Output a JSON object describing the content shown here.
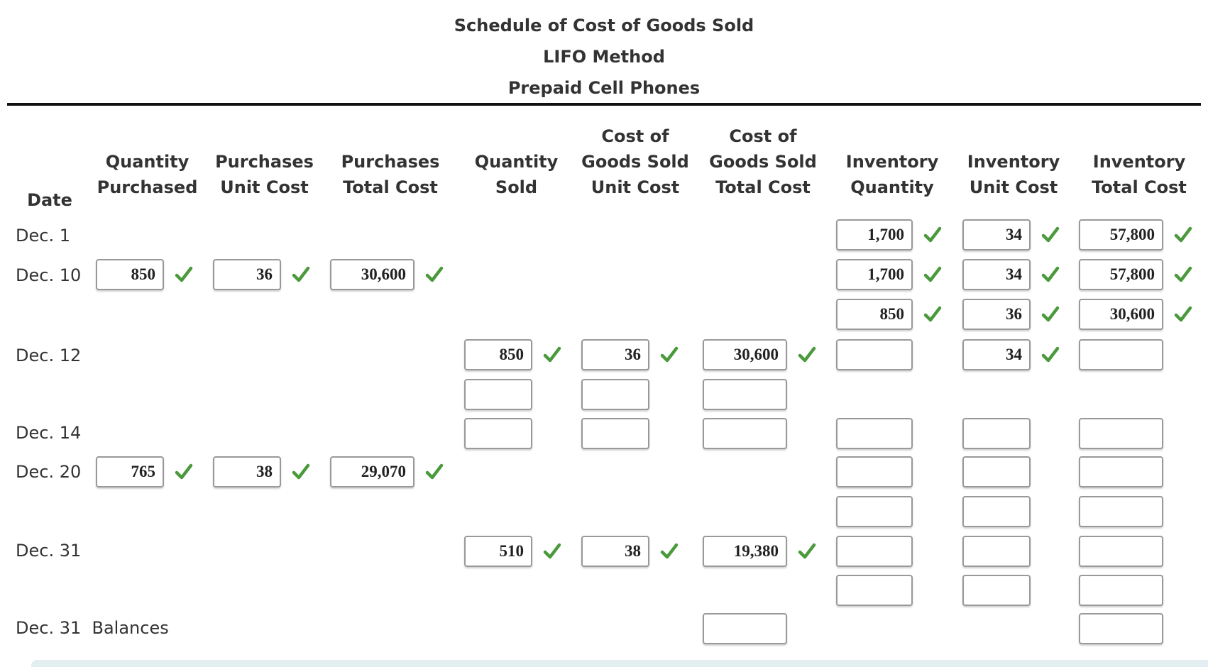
{
  "title": {
    "line1": "Schedule of Cost of Goods Sold",
    "line2": "LIFO Method",
    "line3": "Prepaid Cell Phones"
  },
  "headers": {
    "date": "Date",
    "qty_purchased": [
      "Quantity",
      "Purchased"
    ],
    "purch_unit": [
      "Purchases",
      "Unit Cost"
    ],
    "purch_total": [
      "Purchases",
      "Total Cost"
    ],
    "qty_sold": [
      "Quantity",
      "Sold"
    ],
    "cogs_unit": [
      "Cost of",
      "Goods Sold",
      "Unit Cost"
    ],
    "cogs_total": [
      "Cost of",
      "Goods Sold",
      "Total Cost"
    ],
    "inv_qty": [
      "Inventory",
      "Quantity"
    ],
    "inv_unit": [
      "Inventory",
      "Unit Cost"
    ],
    "inv_total": [
      "Inventory",
      "Total Cost"
    ]
  },
  "dates": {
    "r0": "Dec. 1",
    "r1": "Dec. 10",
    "r3": "Dec. 12",
    "r5": "Dec. 14",
    "r6": "Dec. 20",
    "r8": "Dec. 31",
    "r10": "Dec. 31  Balances"
  },
  "check_color": "#4a9a3c",
  "rows": [
    {
      "inv_qty": {
        "value": "1,700",
        "correct": true
      },
      "inv_unit": {
        "value": "34",
        "correct": true
      },
      "inv_total": {
        "value": "57,800",
        "correct": true
      }
    },
    {
      "qty_purchased": {
        "value": "850",
        "correct": true
      },
      "purch_unit": {
        "value": "36",
        "correct": true
      },
      "purch_total": {
        "value": "30,600",
        "correct": true
      },
      "inv_qty": {
        "value": "1,700",
        "correct": true
      },
      "inv_unit": {
        "value": "34",
        "correct": true
      },
      "inv_total": {
        "value": "57,800",
        "correct": true
      }
    },
    {
      "inv_qty": {
        "value": "850",
        "correct": true
      },
      "inv_unit": {
        "value": "36",
        "correct": true
      },
      "inv_total": {
        "value": "30,600",
        "correct": true
      }
    },
    {
      "qty_sold": {
        "value": "850",
        "correct": true
      },
      "cogs_unit": {
        "value": "36",
        "correct": true
      },
      "cogs_total": {
        "value": "30,600",
        "correct": true
      },
      "inv_qty": {
        "value": "",
        "correct": false
      },
      "inv_unit": {
        "value": "34",
        "correct": true
      },
      "inv_total": {
        "value": "",
        "correct": false
      }
    },
    {
      "qty_sold": {
        "value": "",
        "correct": false
      },
      "cogs_unit": {
        "value": "",
        "correct": false
      },
      "cogs_total": {
        "value": "",
        "correct": false
      }
    },
    {
      "qty_sold": {
        "value": "",
        "correct": false
      },
      "cogs_unit": {
        "value": "",
        "correct": false
      },
      "cogs_total": {
        "value": "",
        "correct": false
      },
      "inv_qty": {
        "value": "",
        "correct": false
      },
      "inv_unit": {
        "value": "",
        "correct": false
      },
      "inv_total": {
        "value": "",
        "correct": false
      }
    },
    {
      "qty_purchased": {
        "value": "765",
        "correct": true
      },
      "purch_unit": {
        "value": "38",
        "correct": true
      },
      "purch_total": {
        "value": "29,070",
        "correct": true
      },
      "inv_qty": {
        "value": "",
        "correct": false
      },
      "inv_unit": {
        "value": "",
        "correct": false
      },
      "inv_total": {
        "value": "",
        "correct": false
      }
    },
    {
      "inv_qty": {
        "value": "",
        "correct": false
      },
      "inv_unit": {
        "value": "",
        "correct": false
      },
      "inv_total": {
        "value": "",
        "correct": false
      }
    },
    {
      "qty_sold": {
        "value": "510",
        "correct": true
      },
      "cogs_unit": {
        "value": "38",
        "correct": true
      },
      "cogs_total": {
        "value": "19,380",
        "correct": true
      },
      "inv_qty": {
        "value": "",
        "correct": false
      },
      "inv_unit": {
        "value": "",
        "correct": false
      },
      "inv_total": {
        "value": "",
        "correct": false
      }
    },
    {
      "inv_qty": {
        "value": "",
        "correct": false
      },
      "inv_unit": {
        "value": "",
        "correct": false
      },
      "inv_total": {
        "value": "",
        "correct": false
      }
    },
    {
      "cogs_total": {
        "value": "",
        "correct": false
      },
      "inv_total": {
        "value": "",
        "correct": false
      }
    }
  ]
}
